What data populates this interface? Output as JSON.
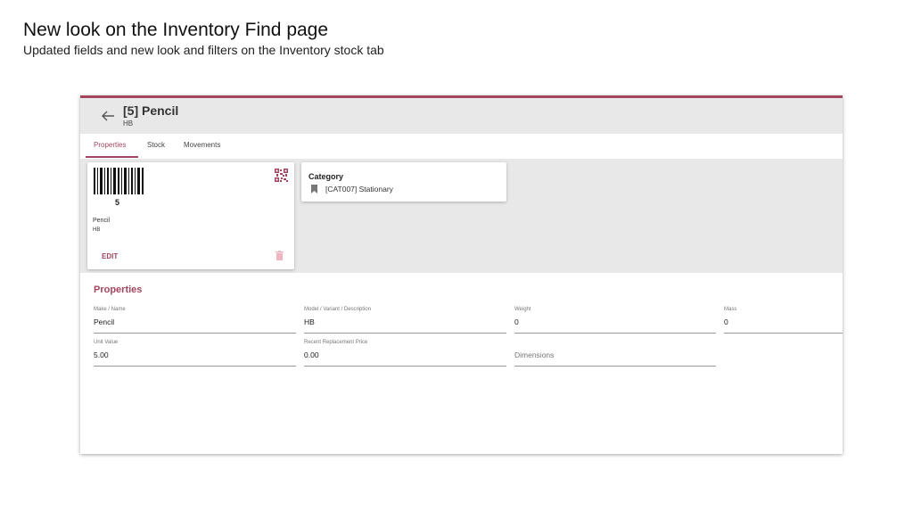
{
  "slide": {
    "title": "New look on the Inventory Find page",
    "subtitle": "Updated fields and new look and filters on the Inventory stock tab"
  },
  "header": {
    "back_icon": "arrow-left-icon",
    "title": "[5] Pencil",
    "subtitle": "HB"
  },
  "tabs": [
    {
      "label": "Properties",
      "active": true
    },
    {
      "label": "Stock",
      "active": false
    },
    {
      "label": "Movements",
      "active": false
    }
  ],
  "item_card": {
    "barcode_icon": "barcode-icon",
    "barcode_number": "5",
    "qr_icon": "qr-code-icon",
    "name": "Pencil",
    "variant": "HB",
    "edit_label": "EDIT",
    "delete_icon": "trash-icon"
  },
  "category_card": {
    "title": "Category",
    "icon": "bookmark-icon",
    "value": "[CAT007] Stationary"
  },
  "properties": {
    "section_title": "Properties",
    "fields": [
      {
        "label": "Make / Name",
        "value": "Pencil"
      },
      {
        "label": "Model / Variant / Description",
        "value": "HB"
      },
      {
        "label": "Weight",
        "value": "0"
      },
      {
        "label": "Mass",
        "value": "0"
      },
      {
        "label": "Unit Value",
        "value": "5.00"
      },
      {
        "label": "Recent Replacement Price",
        "value": "0.00"
      },
      {
        "label": "",
        "placeholder": "Dimensions",
        "value": ""
      }
    ]
  },
  "colors": {
    "accent": "#a3455f",
    "header_bg": "#e8e8e8"
  }
}
